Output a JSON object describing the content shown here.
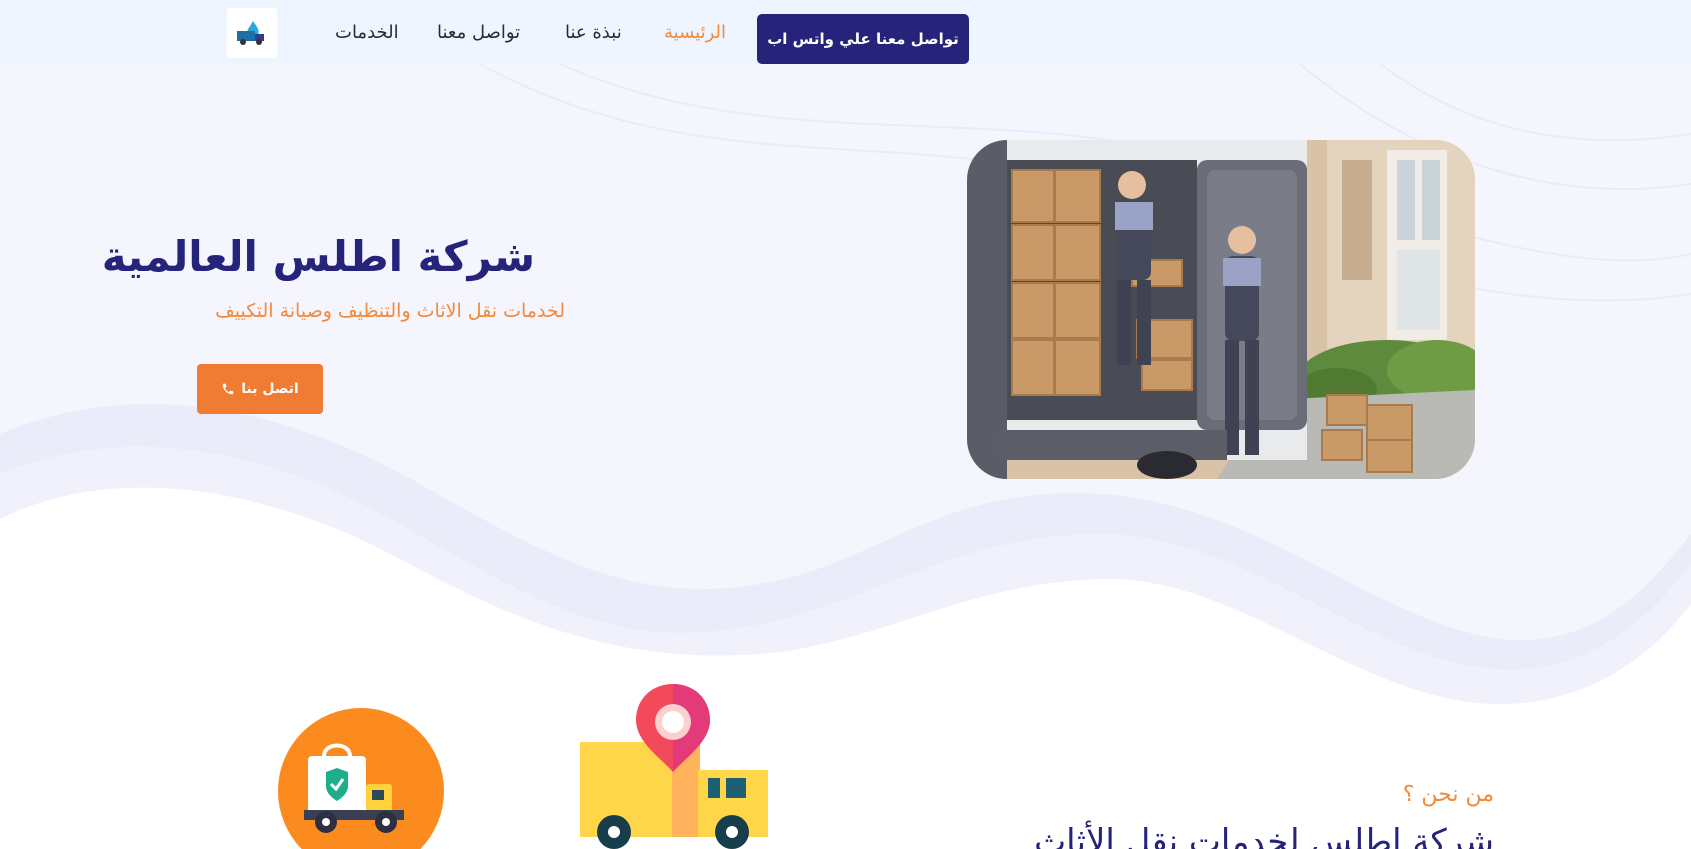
{
  "header": {
    "logo_icon": "moving-truck-logo-icon",
    "nav": [
      {
        "label": "الخدمات",
        "active": false
      },
      {
        "label": "تواصل معنا",
        "active": false
      },
      {
        "label": "نبذة عنا",
        "active": false
      },
      {
        "label": "الرئيسية",
        "active": true
      }
    ],
    "whatsapp_button": "تواصل معنا علي واتس اب"
  },
  "hero": {
    "title": "شركة اطلس العالمية",
    "subtitle": "لخدمات نقل الاثاث والتنظيف وصيانة التكييف",
    "call_button": "اتصل بنا",
    "call_icon": "phone-icon"
  },
  "about": {
    "kicker": "من نحن ؟",
    "title": "شركة اطلس لخدمات نقل الأثاث"
  },
  "colors": {
    "navy": "#25237a",
    "orange": "#f08a3c",
    "header_bg": "#eef5ff",
    "hero_bg": "#f5f5fd"
  }
}
